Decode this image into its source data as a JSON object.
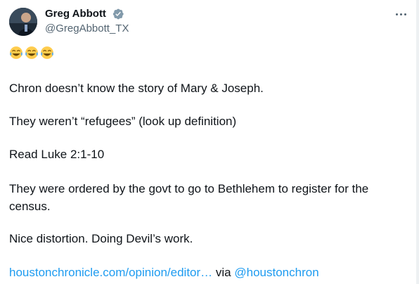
{
  "author": {
    "name": "Greg Abbott",
    "handle": "@GregAbbott_TX"
  },
  "tweet": {
    "emoji": [
      "😂",
      "😂",
      "😂"
    ],
    "lines": [
      "Chron doesn’t know the story of Mary & Joseph.",
      "They weren’t “refugees” (look up definition)",
      "Read Luke 2:1-10",
      "They were ordered by the govt to go to Bethlehem to register for the",
      "census.",
      "Nice distortion. Doing Devil’s work."
    ],
    "link_text": "houstonchronicle.com/opinion/editor…",
    "via_text": "via",
    "via_handle": "@houstonchron"
  },
  "icons": {
    "verified": "verified-badge-icon",
    "more": "more-options-icon"
  },
  "colors": {
    "text": "#0f1419",
    "secondary": "#536471",
    "link": "#1d9bf0",
    "verified_badge": "#829aab"
  }
}
